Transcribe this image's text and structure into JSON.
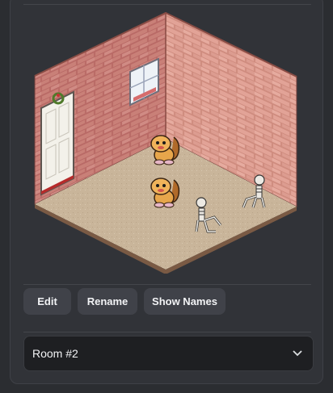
{
  "room_preview": {
    "wall_color": "#c98078",
    "floor_color": "#c9b59a",
    "door_color": "#f3f1ea",
    "icons": [
      "window-icon",
      "door-icon",
      "wreath-icon",
      "bear-figure-icon",
      "skeleton-icon"
    ]
  },
  "actions": {
    "edit_label": "Edit",
    "rename_label": "Rename",
    "show_names_label": "Show Names"
  },
  "room_select": {
    "value": "Room #2",
    "icon": "chevron-down-icon"
  }
}
